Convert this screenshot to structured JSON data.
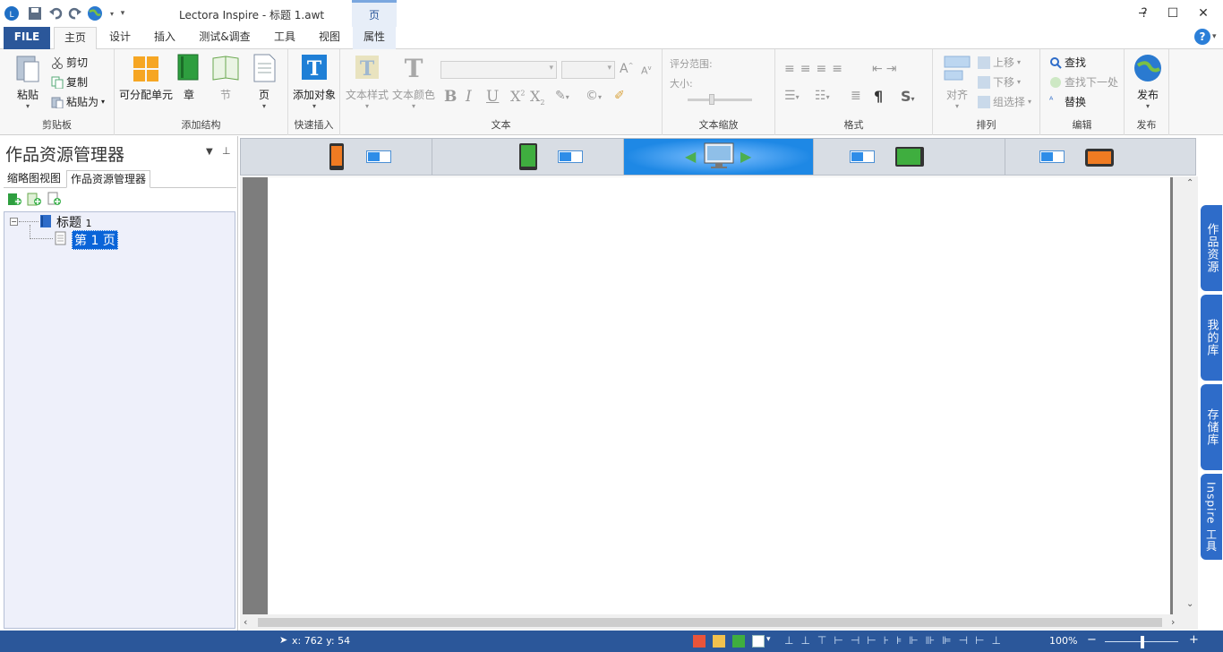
{
  "app": {
    "title": "Lectora Inspire - 标题 1.awt",
    "context_tab_group": "页"
  },
  "window": {
    "minimize": "─",
    "maximize": "☐",
    "close": "✕",
    "help": "?"
  },
  "tabs": [
    "FILE",
    "主页",
    "设计",
    "插入",
    "测试&调查",
    "工具",
    "视图",
    "属性"
  ],
  "ribbon": {
    "clipboard": {
      "paste": "粘贴",
      "cut": "剪切",
      "copy": "复制",
      "paste_as": "粘贴为",
      "label": "剪贴板"
    },
    "structure": {
      "assignable_unit": "可分配单元",
      "chapter": "章",
      "section": "节",
      "page": "页",
      "label": "添加结构"
    },
    "quick_insert": {
      "add_object": "添加对象",
      "label": "快速插入"
    },
    "text": {
      "text_style": "文本样式",
      "text_color": "文本颜色",
      "label": "文本"
    },
    "text_scale": {
      "rating_range": "评分范围:",
      "size": "大小:",
      "label": "文本缩放"
    },
    "format": {
      "label": "格式"
    },
    "arrange": {
      "align": "对齐",
      "move_up": "上移",
      "move_down": "下移",
      "group_select": "组选择",
      "label": "排列"
    },
    "edit": {
      "find": "查找",
      "find_next": "查找下一处",
      "replace": "替换",
      "label": "编辑"
    },
    "publish": {
      "publish": "发布",
      "label": "发布"
    }
  },
  "left_panel": {
    "title": "作品资源管理器",
    "tabs": [
      "缩略图视图",
      "作品资源管理器"
    ],
    "tree": {
      "root": "标题",
      "root_num": "1",
      "page": "第 1 页"
    }
  },
  "right_tabs": [
    "作品资源",
    "我的库",
    "存储库",
    "Inspire 工具"
  ],
  "status": {
    "coords": "x: 762  y: 54",
    "zoom": "100%",
    "zoom_out": "−",
    "zoom_in": "+"
  },
  "colors": {
    "accent": "#2b579a",
    "device_active": "#1e88e5"
  }
}
